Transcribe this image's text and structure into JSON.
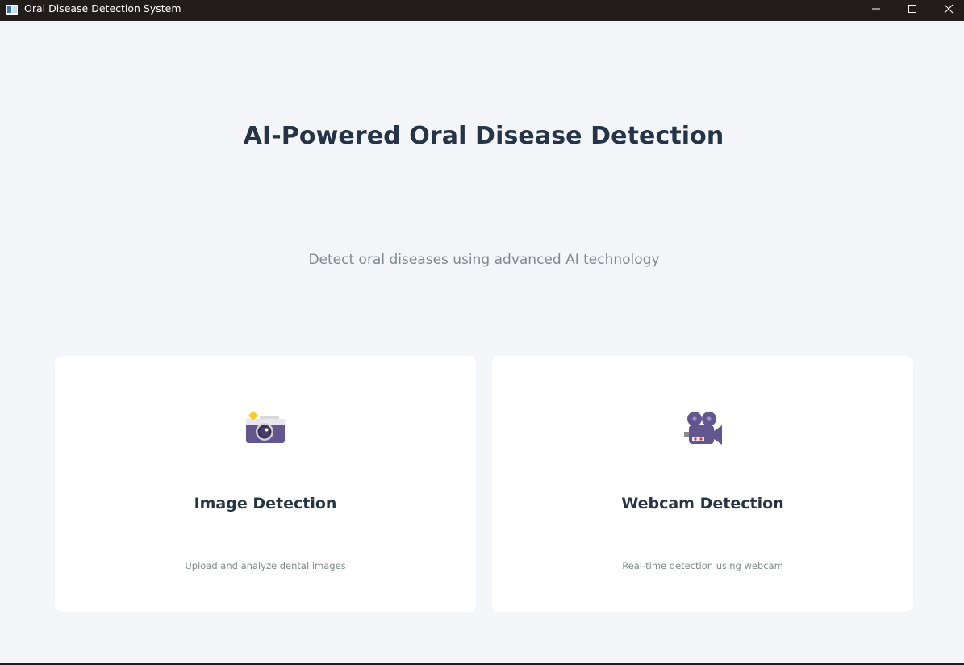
{
  "window": {
    "title": "Oral Disease Detection System",
    "icons": {
      "app": "app-window-icon",
      "minimize": "minimize-icon",
      "maximize": "maximize-icon",
      "close": "close-icon"
    }
  },
  "main": {
    "title": "AI-Powered Oral Disease Detection",
    "subtitle": "Detect oral diseases using advanced AI technology"
  },
  "cards": [
    {
      "icon": "camera-icon",
      "title": "Image Detection",
      "description": "Upload and analyze dental images"
    },
    {
      "icon": "video-camera-icon",
      "title": "Webcam Detection",
      "description": "Real-time detection using webcam"
    }
  ],
  "colors": {
    "background": "#f4f5f9",
    "titlebar": "#221d1c",
    "heading": "#253447",
    "muted_text": "#7f8a8d",
    "card": "#ffffff",
    "icon_purple": "#63568f",
    "icon_yellow": "#f9cc2a"
  }
}
